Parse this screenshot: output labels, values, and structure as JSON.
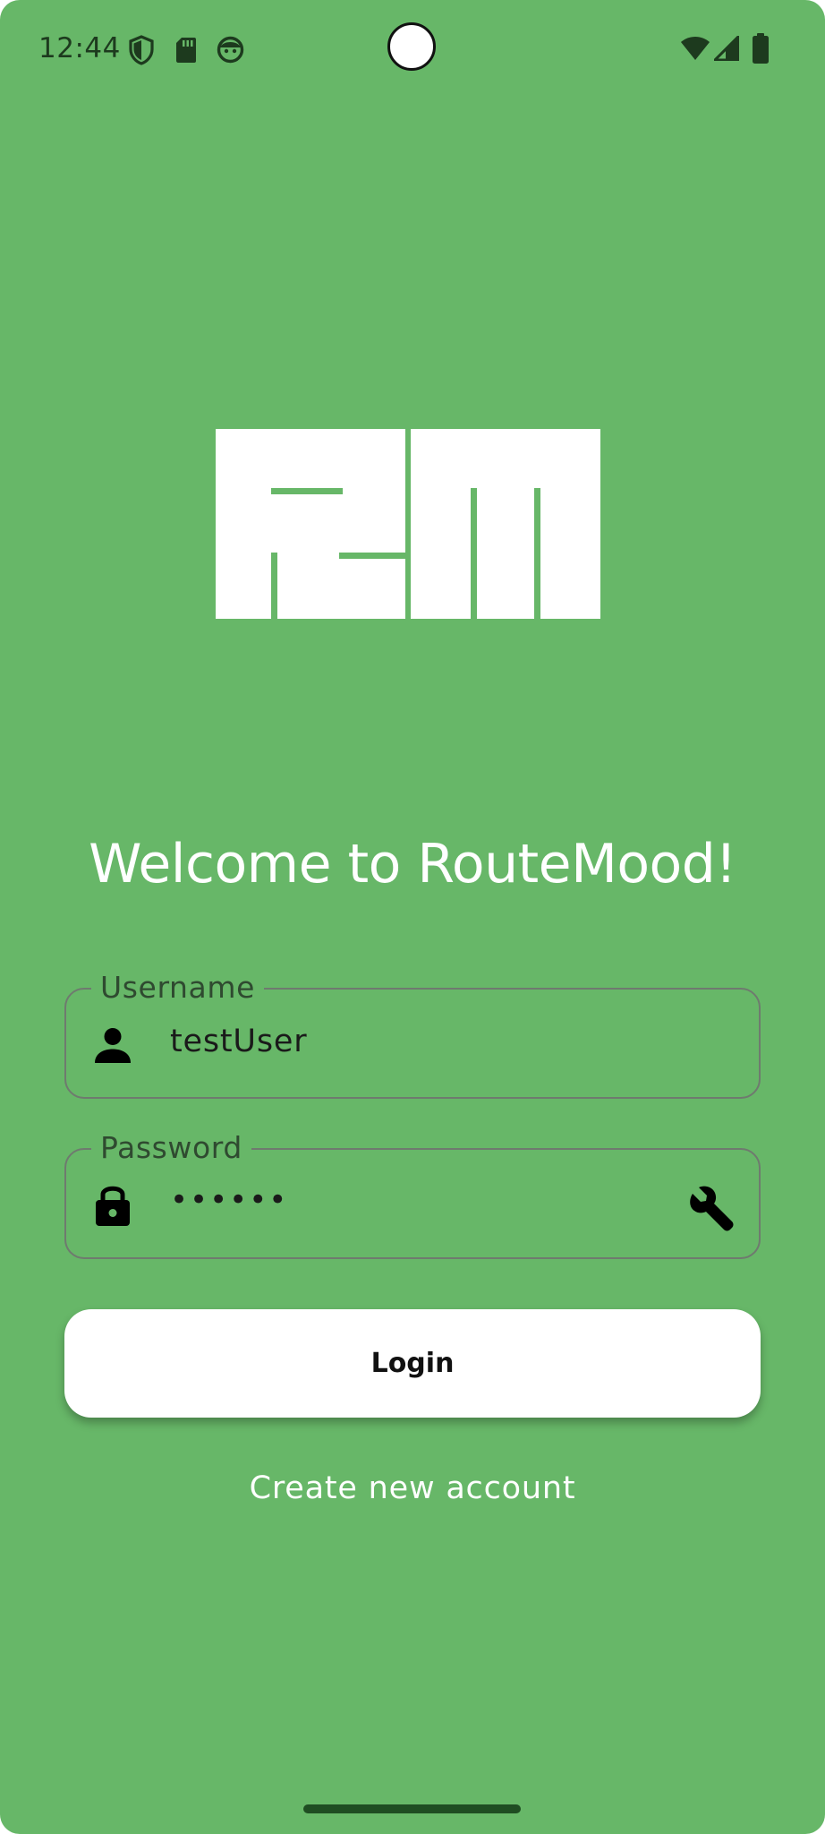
{
  "status_bar": {
    "time": "12:44",
    "left_icons": [
      "shield-icon",
      "sd-card-icon",
      "notification-face-icon"
    ],
    "right_icons": [
      "wifi-icon",
      "cell-signal-icon",
      "battery-icon"
    ]
  },
  "logo": {
    "name": "routemood-logo"
  },
  "welcome": {
    "title": "Welcome to RouteMood!"
  },
  "form": {
    "username": {
      "label": "Username",
      "value": "testUser",
      "icon": "person-icon"
    },
    "password": {
      "label": "Password",
      "value": "••••••",
      "icon": "lock-icon",
      "trailing_icon": "wrench-icon"
    },
    "login_label": "Login",
    "create_account_label": "Create new account"
  },
  "colors": {
    "background": "#67b768",
    "button": "#ffffff",
    "text_light": "#ffffff",
    "field_border": "#6f7a6f"
  }
}
